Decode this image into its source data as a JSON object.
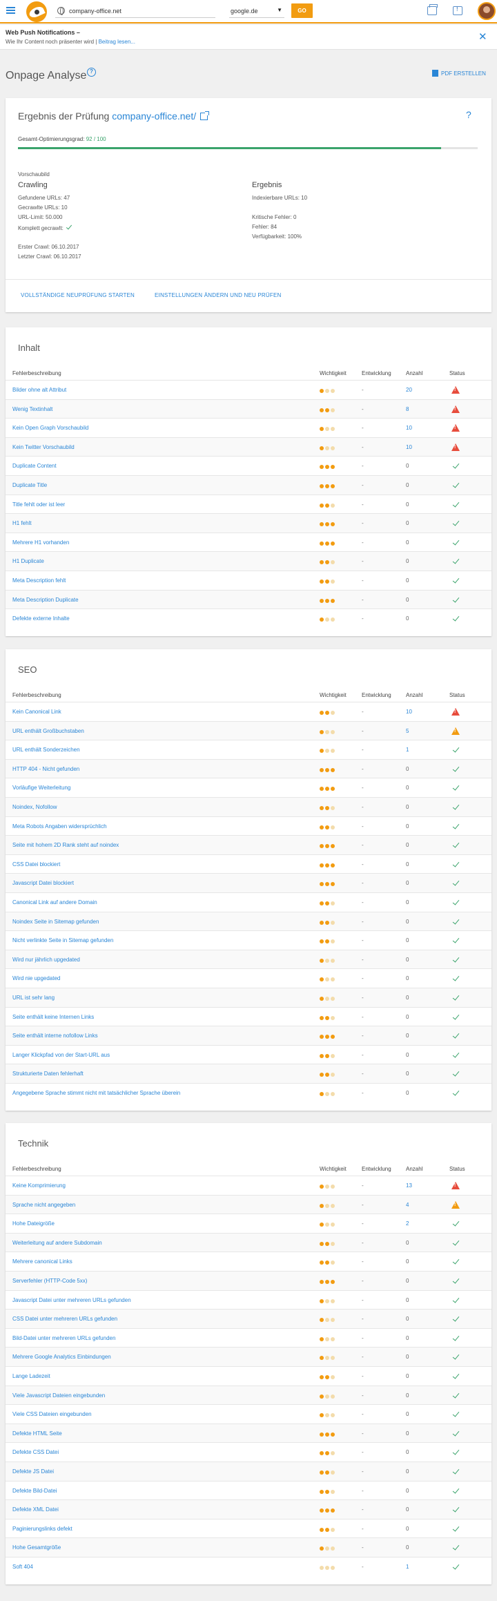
{
  "topbar": {
    "url": "company-office.net",
    "engine": "google.de",
    "go": "GO"
  },
  "notification": {
    "title": "Web Push Notifications –",
    "text": "Wie Ihr Content noch präsenter wird | ",
    "link": "Beitrag lesen..."
  },
  "page": {
    "title": "Onpage Analyse",
    "help": "?",
    "pdf": "PDF ERSTELLEN"
  },
  "result": {
    "title": "Ergebnis der Prüfung",
    "domain": "company-office.net/",
    "help": "?",
    "gesamt_label": "Gesamt-Optimierungsgrad:",
    "gesamt_value": "92 / 100",
    "score": 0.92,
    "vorschau": "Vorschaubild",
    "crawling": {
      "heading": "Crawling",
      "gefunden": "Gefundene URLs: 47",
      "gecrawlt": "Gecrawlte URLs: 10",
      "limit": "URL-Limit: 50.000",
      "komplett": "Komplett gecrawlt:",
      "erster": "Erster Crawl: 06.10.2017",
      "letzter": "Letzter Crawl: 06.10.2017"
    },
    "ergebnis": {
      "heading": "Ergebnis",
      "indexierbar": "Indexierbare URLs: 10",
      "kritisch": "Kritische Fehler: 0",
      "fehler": "Fehler: 84",
      "verfuegbar": "Verfügbarkeit: 100%"
    },
    "action1": "VOLLSTÄNDIGE NEUPRÜFUNG STARTEN",
    "action2": "EINSTELLUNGEN ÄNDERN UND NEU PRÜFEN"
  },
  "columns": {
    "desc": "Fehlerbeschreibung",
    "imp": "Wichtigkeit",
    "dev": "Entwicklung",
    "count": "Anzahl",
    "status": "Status"
  },
  "sections": [
    {
      "title": "Inhalt",
      "rows": [
        {
          "name": "Bilder ohne alt Attribut",
          "imp": 1,
          "dev": "-",
          "count": "20",
          "status": "error"
        },
        {
          "name": "Wenig Textinhalt",
          "imp": 2,
          "dev": "-",
          "count": "8",
          "status": "error"
        },
        {
          "name": "Kein Open Graph Vorschaubild",
          "imp": 1,
          "dev": "-",
          "count": "10",
          "status": "error"
        },
        {
          "name": "Kein Twitter Vorschaubild",
          "imp": 1,
          "dev": "-",
          "count": "10",
          "status": "error"
        },
        {
          "name": "Duplicate Content",
          "imp": 3,
          "dev": "-",
          "count": "0",
          "status": "ok"
        },
        {
          "name": "Duplicate Title",
          "imp": 3,
          "dev": "-",
          "count": "0",
          "status": "ok"
        },
        {
          "name": "Title fehlt oder ist leer",
          "imp": 2,
          "dev": "-",
          "count": "0",
          "status": "ok"
        },
        {
          "name": "H1 fehlt",
          "imp": 3,
          "dev": "-",
          "count": "0",
          "status": "ok"
        },
        {
          "name": "Mehrere H1 vorhanden",
          "imp": 3,
          "dev": "-",
          "count": "0",
          "status": "ok"
        },
        {
          "name": "H1 Duplicate",
          "imp": 2,
          "dev": "-",
          "count": "0",
          "status": "ok"
        },
        {
          "name": "Meta Description fehlt",
          "imp": 2,
          "dev": "-",
          "count": "0",
          "status": "ok"
        },
        {
          "name": "Meta Description Duplicate",
          "imp": 3,
          "dev": "-",
          "count": "0",
          "status": "ok"
        },
        {
          "name": "Defekte externe Inhalte",
          "imp": 1,
          "dev": "-",
          "count": "0",
          "status": "ok"
        }
      ]
    },
    {
      "title": "SEO",
      "rows": [
        {
          "name": "Kein Canonical Link",
          "imp": 2,
          "dev": "-",
          "count": "10",
          "status": "error"
        },
        {
          "name": "URL enthält Großbuchstaben",
          "imp": 1,
          "dev": "-",
          "count": "5",
          "status": "warn"
        },
        {
          "name": "URL enthält Sonderzeichen",
          "imp": 1,
          "dev": "-",
          "count": "1",
          "status": "ok"
        },
        {
          "name": "HTTP 404 - Nicht gefunden",
          "imp": 3,
          "dev": "-",
          "count": "0",
          "status": "ok"
        },
        {
          "name": "Vorläufige Weiterleitung",
          "imp": 3,
          "dev": "-",
          "count": "0",
          "status": "ok"
        },
        {
          "name": "Noindex, Nofollow",
          "imp": 2,
          "dev": "-",
          "count": "0",
          "status": "ok"
        },
        {
          "name": "Meta Robots Angaben widersprüchlich",
          "imp": 2,
          "dev": "-",
          "count": "0",
          "status": "ok"
        },
        {
          "name": "Seite mit hohem 2D Rank steht auf noindex",
          "imp": 3,
          "dev": "-",
          "count": "0",
          "status": "ok"
        },
        {
          "name": "CSS Datei blockiert",
          "imp": 3,
          "dev": "-",
          "count": "0",
          "status": "ok"
        },
        {
          "name": "Javascript Datei blockiert",
          "imp": 3,
          "dev": "-",
          "count": "0",
          "status": "ok"
        },
        {
          "name": "Canonical Link auf andere Domain",
          "imp": 2,
          "dev": "-",
          "count": "0",
          "status": "ok"
        },
        {
          "name": "Noindex Seite in Sitemap gefunden",
          "imp": 2,
          "dev": "-",
          "count": "0",
          "status": "ok"
        },
        {
          "name": "Nicht verlinkte Seite in Sitemap gefunden",
          "imp": 2,
          "dev": "-",
          "count": "0",
          "status": "ok"
        },
        {
          "name": "Wird nur jährlich upgedated",
          "imp": 1,
          "dev": "-",
          "count": "0",
          "status": "ok"
        },
        {
          "name": "Wird nie upgedated",
          "imp": 1,
          "dev": "-",
          "count": "0",
          "status": "ok"
        },
        {
          "name": "URL ist sehr lang",
          "imp": 1,
          "dev": "-",
          "count": "0",
          "status": "ok"
        },
        {
          "name": "Seite enthält keine Internen Links",
          "imp": 2,
          "dev": "-",
          "count": "0",
          "status": "ok"
        },
        {
          "name": "Seite enthält interne nofollow Links",
          "imp": 3,
          "dev": "-",
          "count": "0",
          "status": "ok"
        },
        {
          "name": "Langer Klickpfad von der Start-URL aus",
          "imp": 2,
          "dev": "-",
          "count": "0",
          "status": "ok"
        },
        {
          "name": "Strukturierte Daten fehlerhaft",
          "imp": 2,
          "dev": "-",
          "count": "0",
          "status": "ok"
        },
        {
          "name": "Angegebene Sprache stimmt nicht mit tatsächlicher Sprache überein",
          "imp": 1,
          "dev": "-",
          "count": "0",
          "status": "ok"
        }
      ]
    },
    {
      "title": "Technik",
      "rows": [
        {
          "name": "Keine Komprimierung",
          "imp": 1,
          "dev": "-",
          "count": "13",
          "status": "error"
        },
        {
          "name": "Sprache nicht angegeben",
          "imp": 1,
          "dev": "-",
          "count": "4",
          "status": "warn"
        },
        {
          "name": "Hohe Dateigröße",
          "imp": 1,
          "dev": "-",
          "count": "2",
          "status": "ok"
        },
        {
          "name": "Weiterleitung auf andere Subdomain",
          "imp": 2,
          "dev": "-",
          "count": "0",
          "status": "ok"
        },
        {
          "name": "Mehrere canonical Links",
          "imp": 2,
          "dev": "-",
          "count": "0",
          "status": "ok"
        },
        {
          "name": "Serverfehler (HTTP-Code 5xx)",
          "imp": 3,
          "dev": "-",
          "count": "0",
          "status": "ok"
        },
        {
          "name": "Javascript Datei unter mehreren URLs gefunden",
          "imp": 1,
          "dev": "-",
          "count": "0",
          "status": "ok"
        },
        {
          "name": "CSS Datei unter mehreren URLs gefunden",
          "imp": 1,
          "dev": "-",
          "count": "0",
          "status": "ok"
        },
        {
          "name": "Bild-Datei unter mehreren URLs gefunden",
          "imp": 1,
          "dev": "-",
          "count": "0",
          "status": "ok"
        },
        {
          "name": "Mehrere Google Analytics Einbindungen",
          "imp": 1,
          "dev": "-",
          "count": "0",
          "status": "ok"
        },
        {
          "name": "Lange Ladezeit",
          "imp": 2,
          "dev": "-",
          "count": "0",
          "status": "ok"
        },
        {
          "name": "Viele Javascript Dateien eingebunden",
          "imp": 1,
          "dev": "-",
          "count": "0",
          "status": "ok"
        },
        {
          "name": "Viele CSS Dateien eingebunden",
          "imp": 1,
          "dev": "-",
          "count": "0",
          "status": "ok"
        },
        {
          "name": "Defekte HTML Seite",
          "imp": 3,
          "dev": "-",
          "count": "0",
          "status": "ok"
        },
        {
          "name": "Defekte CSS Datei",
          "imp": 2,
          "dev": "-",
          "count": "0",
          "status": "ok"
        },
        {
          "name": "Defekte JS Datei",
          "imp": 2,
          "dev": "-",
          "count": "0",
          "status": "ok"
        },
        {
          "name": "Defekte Bild-Datei",
          "imp": 2,
          "dev": "-",
          "count": "0",
          "status": "ok"
        },
        {
          "name": "Defekte XML Datei",
          "imp": 3,
          "dev": "-",
          "count": "0",
          "status": "ok"
        },
        {
          "name": "Paginierungslinks defekt",
          "imp": 2,
          "dev": "-",
          "count": "0",
          "status": "ok"
        },
        {
          "name": "Hohe Gesamtgröße",
          "imp": 1,
          "dev": "-",
          "count": "0",
          "status": "ok"
        },
        {
          "name": "Soft 404",
          "imp": 0,
          "dev": "-",
          "count": "1",
          "status": "ok"
        }
      ]
    }
  ]
}
